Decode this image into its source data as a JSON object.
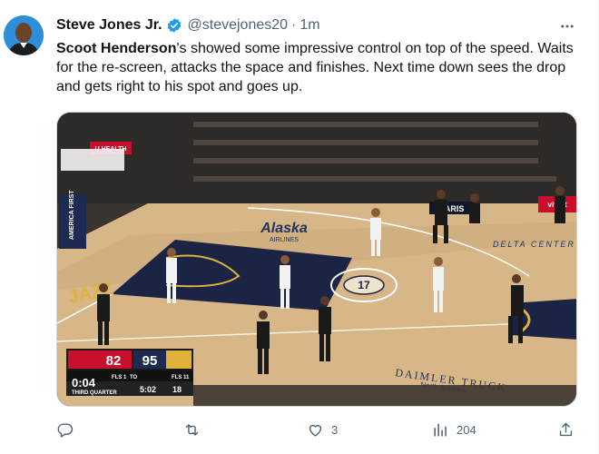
{
  "tweet": {
    "author_name": "Steve Jones Jr.",
    "handle": "@stevejones20",
    "separator": "·",
    "timestamp": "1m",
    "text_bold": "Scoot Henderson",
    "text_rest": "'s showed some impressive control on top of the speed. Waits for the re-screen, attacks the space and finishes. Next time down sees the drop and gets right to his spot and goes up."
  },
  "media": {
    "score": {
      "away_score": "82",
      "home_score": "95",
      "away_fouls": "FLS 1",
      "away_timeouts": "TO",
      "home_fouls": "FLS 11",
      "shot_clock": "0:04",
      "quarter": "THIRD QUARTER",
      "game_clock": "5:02",
      "shot_clock_num": "18"
    },
    "court_texts": {
      "center_logo": "Alaska",
      "center_sub": "AIRLINES",
      "delta": "DELTA CENTER",
      "jazz": "JAZZ",
      "daimler": "DAIMLER TRUCK",
      "daimler_sub": "North America",
      "circle_num": "17",
      "banner_health": "U HEALTH",
      "banner_america": "AMERICA FIRST",
      "banner_paris": "PARIS",
      "banner_vivint": "vivint"
    }
  },
  "actions": {
    "reply_count": "",
    "retweet_count": "",
    "like_count": "3",
    "views_count": "204"
  },
  "colors": {
    "verified": "#1d9bf0",
    "court": "#d7b788",
    "paint": "#1b2444"
  }
}
